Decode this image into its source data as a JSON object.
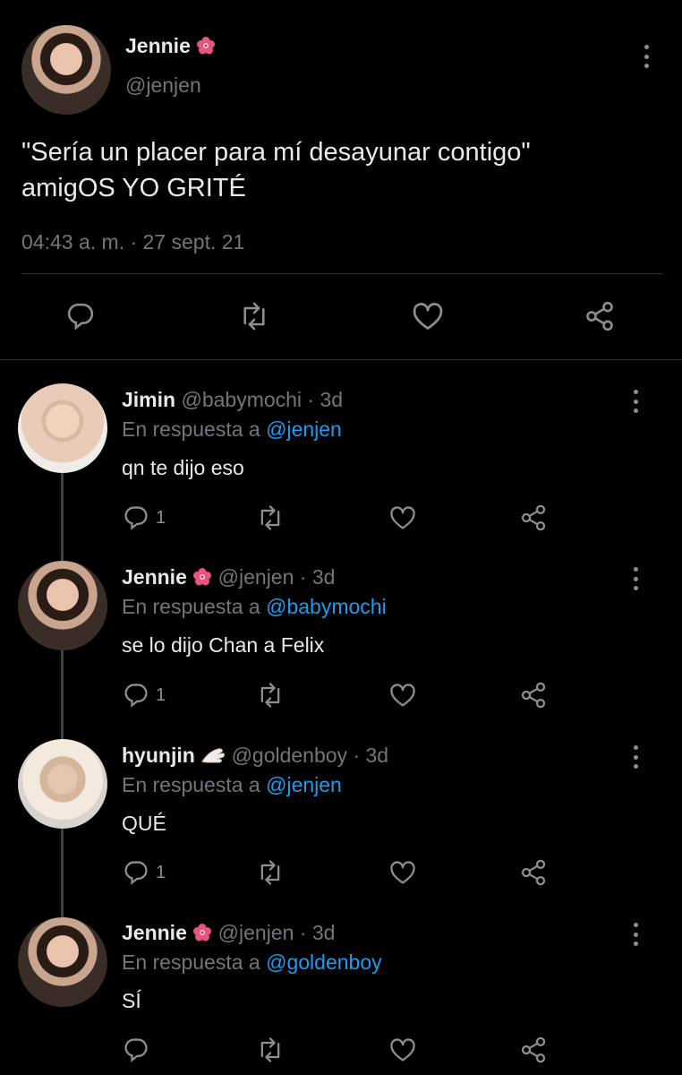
{
  "main_tweet": {
    "author_name": "Jennie",
    "author_handle": "@jenjen",
    "text_line1": "\"Sería un placer para mí desayunar contigo\"",
    "text_line2": "amigOS YO GRITÉ",
    "timestamp": "04:43 a. m. · 27 sept. 21"
  },
  "replies": [
    {
      "name": "Jimin",
      "handle": "@babymochi",
      "time": "· 3d",
      "replying_prefix": "En respuesta a",
      "replying_to": "@jenjen",
      "text": "qn te dijo eso",
      "reply_count": "1"
    },
    {
      "name": "Jennie",
      "handle": "@jenjen",
      "time": "· 3d",
      "replying_prefix": "En respuesta a",
      "replying_to": "@babymochi",
      "text": "se lo dijo Chan a Felix",
      "reply_count": "1"
    },
    {
      "name": "hyunjin",
      "handle": "@goldenboy",
      "time": "· 3d",
      "replying_prefix": "En respuesta a",
      "replying_to": "@jenjen",
      "text": "QUÉ",
      "reply_count": "1"
    },
    {
      "name": "Jennie",
      "handle": "@jenjen",
      "time": "· 3d",
      "replying_prefix": "En respuesta a",
      "replying_to": "@goldenboy",
      "text": "SÍ",
      "reply_count": ""
    }
  ],
  "icons": {
    "reply": "reply-icon",
    "retweet": "retweet-icon",
    "like": "heart-icon",
    "share": "share-icon",
    "more": "more-icon",
    "flower": "hibiscus-icon",
    "hand": "hand-icon"
  },
  "colors": {
    "background": "#000000",
    "text": "#e7e9ea",
    "muted": "#71767b",
    "link": "#1d9bf0"
  }
}
